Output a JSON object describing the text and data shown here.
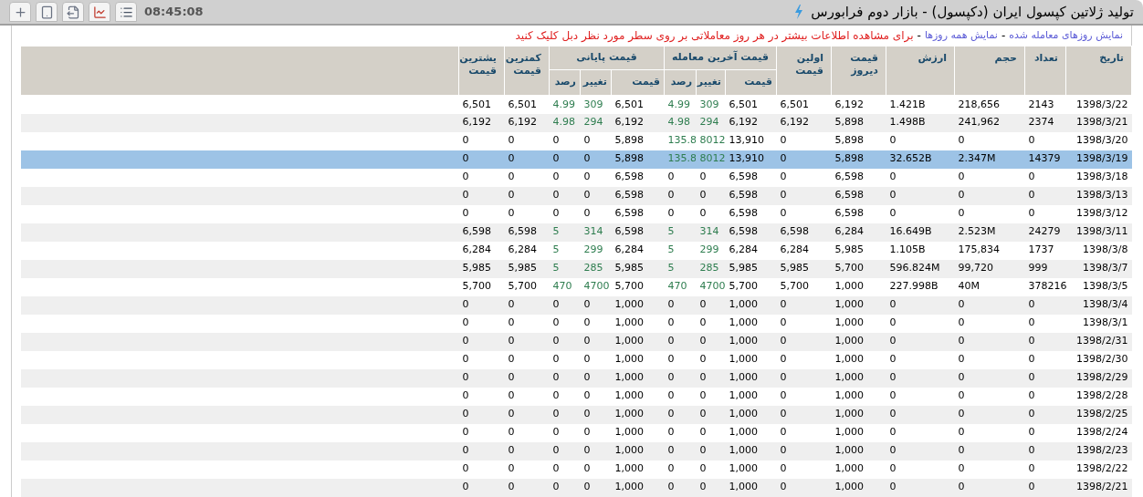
{
  "window": {
    "title": "تولید ژلاتین کپسول ایران (دکپسول) - بازار دوم فرابورس",
    "time": "08:45:08"
  },
  "toolbar": [
    {
      "kind": "plus"
    },
    {
      "kind": "device"
    },
    {
      "kind": "export"
    },
    {
      "kind": "chart"
    },
    {
      "kind": "list"
    }
  ],
  "notice": [
    {
      "kind": "link",
      "text": "نمایش روزهای معامله شده"
    },
    {
      "kind": "separator",
      "text": "-"
    },
    {
      "kind": "link",
      "text": "نمایش همه روزها"
    },
    {
      "kind": "separator",
      "text": "-"
    },
    {
      "kind": "hint",
      "text": "برای مشاهده اطلاعات بیشتر در هر روز معاملاتی بر روی سطر مورد نظر دبل کلیک کنید"
    }
  ],
  "table": {
    "columns": [
      {
        "kind": "single",
        "label": "یشترین قیمت"
      },
      {
        "kind": "single",
        "label": "کمترین قیمت"
      },
      {
        "kind": "group",
        "label": "قیمت پایانی",
        "colspan": 3,
        "sub": [
          "رصد",
          "تغییر",
          "قیمت"
        ]
      },
      {
        "kind": "group",
        "label": "قیمت آخرین معامله",
        "colspan": 3,
        "sub": [
          "رصد",
          "تغییر",
          "قیمت"
        ]
      },
      {
        "kind": "single",
        "label": "اولین قیمت"
      },
      {
        "kind": "single",
        "label": "قیمت دیروز"
      },
      {
        "kind": "single",
        "label": "ارزش"
      },
      {
        "kind": "single",
        "label": "حجم"
      },
      {
        "kind": "single",
        "label": "تعداد"
      },
      {
        "kind": "single",
        "label": "تاریخ"
      }
    ],
    "rows": [
      {
        "selected": false,
        "last_up": true,
        "close_up": true,
        "cells": [
          "6,501",
          "6,501",
          "4.99",
          "309",
          "6,501",
          "4.99",
          "309",
          "6,501",
          "6,501",
          "6,192",
          "1.421B",
          "218,656",
          "2143",
          "1398/3/22"
        ]
      },
      {
        "selected": false,
        "last_up": true,
        "close_up": true,
        "cells": [
          "6,192",
          "6,192",
          "4.98",
          "294",
          "6,192",
          "4.98",
          "294",
          "6,192",
          "6,192",
          "5,898",
          "1.498B",
          "241,962",
          "2374",
          "1398/3/21"
        ]
      },
      {
        "selected": false,
        "last_up": true,
        "close_up": false,
        "cells": [
          "0",
          "0",
          "0",
          "0",
          "5,898",
          "135.8",
          "8012",
          "13,910",
          "0",
          "5,898",
          "0",
          "0",
          "0",
          "1398/3/20"
        ]
      },
      {
        "selected": true,
        "last_up": true,
        "close_up": false,
        "cells": [
          "0",
          "0",
          "0",
          "0",
          "5,898",
          "135.8",
          "8012",
          "13,910",
          "0",
          "5,898",
          "32.652B",
          "2.347M",
          "14379",
          "1398/3/19"
        ]
      },
      {
        "selected": false,
        "last_up": false,
        "close_up": false,
        "cells": [
          "0",
          "0",
          "0",
          "0",
          "6,598",
          "0",
          "0",
          "6,598",
          "0",
          "6,598",
          "0",
          "0",
          "0",
          "1398/3/18"
        ]
      },
      {
        "selected": false,
        "last_up": false,
        "close_up": false,
        "cells": [
          "0",
          "0",
          "0",
          "0",
          "6,598",
          "0",
          "0",
          "6,598",
          "0",
          "6,598",
          "0",
          "0",
          "0",
          "1398/3/13"
        ]
      },
      {
        "selected": false,
        "last_up": false,
        "close_up": false,
        "cells": [
          "0",
          "0",
          "0",
          "0",
          "6,598",
          "0",
          "0",
          "6,598",
          "0",
          "6,598",
          "0",
          "0",
          "0",
          "1398/3/12"
        ]
      },
      {
        "selected": false,
        "last_up": true,
        "close_up": true,
        "cells": [
          "6,598",
          "6,598",
          "5",
          "314",
          "6,598",
          "5",
          "314",
          "6,598",
          "6,598",
          "6,284",
          "16.649B",
          "2.523M",
          "24279",
          "1398/3/11"
        ]
      },
      {
        "selected": false,
        "last_up": true,
        "close_up": true,
        "cells": [
          "6,284",
          "6,284",
          "5",
          "299",
          "6,284",
          "5",
          "299",
          "6,284",
          "6,284",
          "5,985",
          "1.105B",
          "175,834",
          "1737",
          "1398/3/8"
        ]
      },
      {
        "selected": false,
        "last_up": true,
        "close_up": true,
        "cells": [
          "5,985",
          "5,985",
          "5",
          "285",
          "5,985",
          "5",
          "285",
          "5,985",
          "5,985",
          "5,700",
          "596.824M",
          "99,720",
          "999",
          "1398/3/7"
        ]
      },
      {
        "selected": false,
        "last_up": true,
        "close_up": true,
        "cells": [
          "5,700",
          "5,700",
          "470",
          "4700",
          "5,700",
          "470",
          "4700",
          "5,700",
          "5,700",
          "1,000",
          "227.998B",
          "40M",
          "378216",
          "1398/3/5"
        ]
      },
      {
        "selected": false,
        "last_up": false,
        "close_up": false,
        "cells": [
          "0",
          "0",
          "0",
          "0",
          "1,000",
          "0",
          "0",
          "1,000",
          "0",
          "1,000",
          "0",
          "0",
          "0",
          "1398/3/4"
        ]
      },
      {
        "selected": false,
        "last_up": false,
        "close_up": false,
        "cells": [
          "0",
          "0",
          "0",
          "0",
          "1,000",
          "0",
          "0",
          "1,000",
          "0",
          "1,000",
          "0",
          "0",
          "0",
          "1398/3/1"
        ]
      },
      {
        "selected": false,
        "last_up": false,
        "close_up": false,
        "cells": [
          "0",
          "0",
          "0",
          "0",
          "1,000",
          "0",
          "0",
          "1,000",
          "0",
          "1,000",
          "0",
          "0",
          "0",
          "1398/2/31"
        ]
      },
      {
        "selected": false,
        "last_up": false,
        "close_up": false,
        "cells": [
          "0",
          "0",
          "0",
          "0",
          "1,000",
          "0",
          "0",
          "1,000",
          "0",
          "1,000",
          "0",
          "0",
          "0",
          "1398/2/30"
        ]
      },
      {
        "selected": false,
        "last_up": false,
        "close_up": false,
        "cells": [
          "0",
          "0",
          "0",
          "0",
          "1,000",
          "0",
          "0",
          "1,000",
          "0",
          "1,000",
          "0",
          "0",
          "0",
          "1398/2/29"
        ]
      },
      {
        "selected": false,
        "last_up": false,
        "close_up": false,
        "cells": [
          "0",
          "0",
          "0",
          "0",
          "1,000",
          "0",
          "0",
          "1,000",
          "0",
          "1,000",
          "0",
          "0",
          "0",
          "1398/2/28"
        ]
      },
      {
        "selected": false,
        "last_up": false,
        "close_up": false,
        "cells": [
          "0",
          "0",
          "0",
          "0",
          "1,000",
          "0",
          "0",
          "1,000",
          "0",
          "1,000",
          "0",
          "0",
          "0",
          "1398/2/25"
        ]
      },
      {
        "selected": false,
        "last_up": false,
        "close_up": false,
        "cells": [
          "0",
          "0",
          "0",
          "0",
          "1,000",
          "0",
          "0",
          "1,000",
          "0",
          "1,000",
          "0",
          "0",
          "0",
          "1398/2/24"
        ]
      },
      {
        "selected": false,
        "last_up": false,
        "close_up": false,
        "cells": [
          "0",
          "0",
          "0",
          "0",
          "1,000",
          "0",
          "0",
          "1,000",
          "0",
          "1,000",
          "0",
          "0",
          "0",
          "1398/2/23"
        ]
      },
      {
        "selected": false,
        "last_up": false,
        "close_up": false,
        "cells": [
          "0",
          "0",
          "0",
          "0",
          "1,000",
          "0",
          "0",
          "1,000",
          "0",
          "1,000",
          "0",
          "0",
          "0",
          "1398/2/22"
        ]
      },
      {
        "selected": false,
        "last_up": false,
        "close_up": false,
        "cells": [
          "0",
          "0",
          "0",
          "0",
          "1,000",
          "0",
          "0",
          "1,000",
          "0",
          "1,000",
          "0",
          "0",
          "0",
          "1398/2/21"
        ]
      }
    ]
  }
}
